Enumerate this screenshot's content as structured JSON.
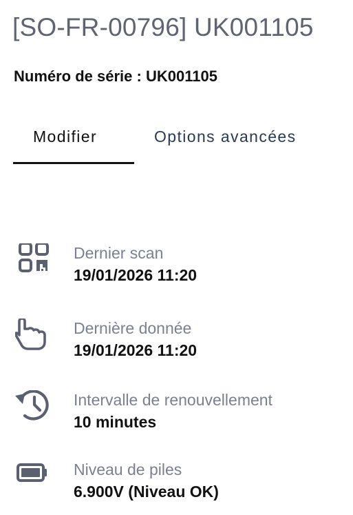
{
  "header": {
    "title": "[SO-FR-00796] UK001105",
    "serial_line": "Numéro de série : UK001105"
  },
  "tabs": {
    "modify": "Modifier",
    "advanced": "Options avancées",
    "active": "Modifier"
  },
  "info": {
    "last_scan": {
      "icon": "qr-code-icon",
      "label": "Dernier scan",
      "value": "19/01/2026 11:20"
    },
    "last_data": {
      "icon": "touch-hand-icon",
      "label": "Dernière donnée",
      "value": "19/01/2026 11:20"
    },
    "interval": {
      "icon": "history-icon",
      "label": "Intervalle de renouvellement",
      "value": "10 minutes"
    },
    "battery": {
      "icon": "battery-full-icon",
      "label": "Niveau de piles",
      "value": "6.900V (Niveau OK)"
    }
  },
  "colors": {
    "title": "#5f6470",
    "label": "#7b8090",
    "icon": "#5b6070",
    "tab_inactive": "#283a55",
    "tab_active": "#111111"
  }
}
